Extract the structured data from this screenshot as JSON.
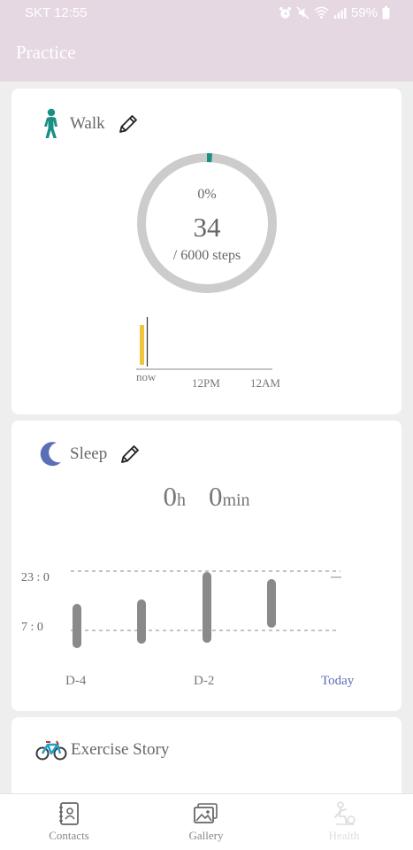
{
  "status_bar": {
    "carrier": "SKT",
    "time": "12:55",
    "battery": "59%"
  },
  "app": {
    "title": "Practice"
  },
  "walk": {
    "title": "Walk",
    "percent": "0%",
    "steps": "34",
    "goal": "/ 6000 steps",
    "progress": 0.0057,
    "axis_labels": [
      "now",
      "12PM",
      "12AM"
    ],
    "accent_color": "#1a8f86",
    "bar_color": "#f0c43c"
  },
  "sleep": {
    "title": "Sleep",
    "hours_value": "0",
    "hours_unit": "h",
    "minutes_value": "0",
    "minutes_unit": "min",
    "y_labels": [
      "23 : 0",
      "7 : 0"
    ],
    "x_labels": [
      "D-4",
      "D-2",
      "Today"
    ],
    "today_color": "#5b6fb8",
    "bar_color": "#8a8a8a"
  },
  "exercise": {
    "title": "Exercise Story"
  },
  "nav": {
    "items": [
      {
        "label": "Contacts"
      },
      {
        "label": "Gallery"
      },
      {
        "label": "Health"
      }
    ]
  }
}
